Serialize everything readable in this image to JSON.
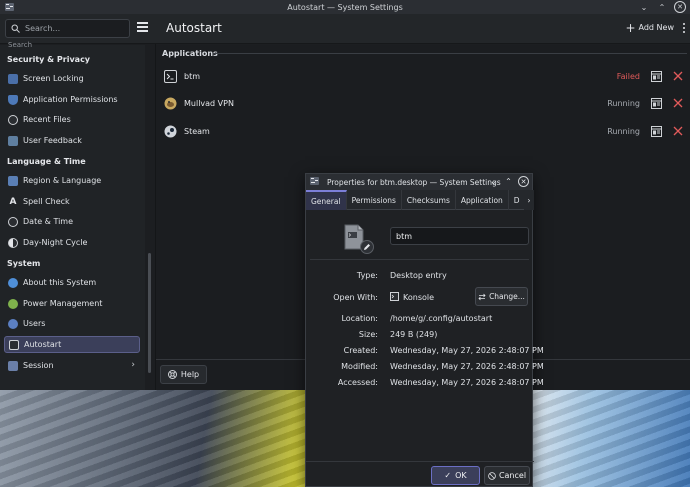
{
  "window": {
    "title": "Autostart — System Settings"
  },
  "toolbar": {
    "search_placeholder": "Search...",
    "page_title": "Autostart",
    "add_new_label": "Add New"
  },
  "sidebar": {
    "cut_item": "Search",
    "sections": [
      {
        "heading": "Security & Privacy",
        "items": [
          {
            "label": "Screen Locking",
            "icon": "screen-lock-icon"
          },
          {
            "label": "Application Permissions",
            "icon": "shield-icon"
          },
          {
            "label": "Recent Files",
            "icon": "recent-files-icon"
          },
          {
            "label": "User Feedback",
            "icon": "feedback-icon"
          }
        ]
      },
      {
        "heading": "Language & Time",
        "items": [
          {
            "label": "Region & Language",
            "icon": "region-icon"
          },
          {
            "label": "Spell Check",
            "icon": "spellcheck-icon"
          },
          {
            "label": "Date & Time",
            "icon": "clock-icon"
          },
          {
            "label": "Day-Night Cycle",
            "icon": "day-night-icon"
          }
        ]
      },
      {
        "heading": "System",
        "items": [
          {
            "label": "About this System",
            "icon": "info-icon"
          },
          {
            "label": "Power Management",
            "icon": "power-icon"
          },
          {
            "label": "Users",
            "icon": "users-icon"
          },
          {
            "label": "Autostart",
            "icon": "autostart-icon",
            "active": true
          },
          {
            "label": "Session",
            "icon": "session-icon",
            "has_children": true
          }
        ]
      }
    ]
  },
  "content": {
    "section_label": "Applications",
    "apps": [
      {
        "name": "btm",
        "status": "Failed",
        "status_color": "#e05a5a",
        "icon": "terminal-icon"
      },
      {
        "name": "Mullvad VPN",
        "status": "Running",
        "status_color": "#a7abb1",
        "icon": "mullvad-icon"
      },
      {
        "name": "Steam",
        "status": "Running",
        "status_color": "#a7abb1",
        "icon": "steam-icon"
      }
    ],
    "help_label": "Help"
  },
  "dialog": {
    "title": "Properties for btm.desktop — System Settings",
    "tabs": [
      "General",
      "Permissions",
      "Checksums",
      "Application",
      "D"
    ],
    "active_tab": "General",
    "file_name": "btm",
    "type_label": "Type:",
    "type_value": "Desktop entry",
    "open_with_label": "Open With:",
    "open_with_value": "Konsole",
    "change_label": "Change...",
    "location_label": "Location:",
    "location_value": "/home/g/.config/autostart",
    "size_label": "Size:",
    "size_value": "249 B (249)",
    "created_label": "Created:",
    "created_value": "Wednesday, May 27, 2026 2:48:07 PM",
    "modified_label": "Modified:",
    "modified_value": "Wednesday, May 27, 2026 2:48:07 PM",
    "accessed_label": "Accessed:",
    "accessed_value": "Wednesday, May 27, 2026 2:48:07 PM",
    "ok_label": "OK",
    "cancel_label": "Cancel"
  },
  "colors": {
    "accent": "#6b6fc4",
    "failed": "#e05a5a",
    "remove": "#e05a5a"
  }
}
